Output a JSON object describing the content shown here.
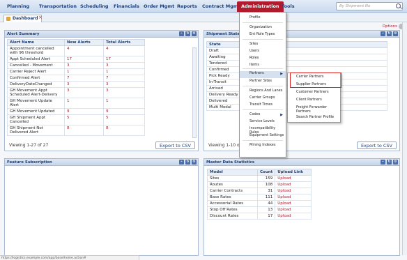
{
  "nav": {
    "items": [
      "Planning",
      "Transportation",
      "Scheduling",
      "Financials",
      "Order Mgmt",
      "Reports",
      "Contract Mgmt",
      "Administration",
      "Tools"
    ],
    "active": "Administration",
    "search_placeholder": "By Shipment No"
  },
  "tab": {
    "label": "Dashboard",
    "close": "×"
  },
  "options_label": "Options",
  "alert_summary": {
    "title": "Alert Summary",
    "columns": [
      "Alert Name",
      "New Alerts",
      "Total Alerts"
    ],
    "rows": [
      [
        "Appointment cancelled with 96 threshold",
        "4",
        "4"
      ],
      [
        "Appt Scheduled Alert",
        "17",
        "17"
      ],
      [
        "Cancelled - Movement",
        "3",
        "3"
      ],
      [
        "Carrier Reject Alert",
        "1",
        "1"
      ],
      [
        "Confirmed Alert",
        "7",
        "7"
      ],
      [
        "DeliveryDateChanged",
        "3",
        "3"
      ],
      [
        "GH Movement Appt Scheduled Alert-Delivery",
        "3",
        "3"
      ],
      [
        "GH Movement Update Alert",
        "1",
        "1"
      ],
      [
        "GH Movement Updated",
        "9",
        "9"
      ],
      [
        "GH Shipment Appt Cancelled",
        "5",
        "5"
      ],
      [
        "GH Shipment Not Delivered Alert",
        "8",
        "8"
      ]
    ],
    "footer": "Viewing 1-27 of 27",
    "csv": "Export to CSV"
  },
  "shipment_state": {
    "title": "Shipment State Su",
    "column": "State",
    "rows": [
      "Draft",
      "Awaiting",
      "Tendered",
      "Confirmed",
      "Pick Ready",
      "In-Transit",
      "Arrived",
      "Delivery Ready",
      "Delivered",
      "Multi Modal"
    ],
    "footer": "Viewing 1-10 of",
    "csv": "Export to CSV"
  },
  "feature_subscription": {
    "title": "Feature Subscription"
  },
  "master_data": {
    "title": "Master Data Statistics",
    "columns": [
      "Model",
      "Count",
      "Upload Link"
    ],
    "rows": [
      [
        "Sites",
        "159",
        "Upload"
      ],
      [
        "Routes",
        "108",
        "Upload"
      ],
      [
        "Carrier Contracts",
        "31",
        "Upload"
      ],
      [
        "Base Rates",
        "111",
        "Upload"
      ],
      [
        "Accessorial Rates",
        "44",
        "Upload"
      ],
      [
        "Stop Off Rates",
        "13",
        "Upload"
      ],
      [
        "Discount Rates",
        "17",
        "Upload"
      ]
    ]
  },
  "admin_menu": {
    "items": [
      "Profile",
      "Organization",
      "Ent Role Types",
      "Sites",
      "Users",
      "Roles",
      "Items",
      "Partners",
      "Partner Sites",
      "Regions And Lanes",
      "Carrier Groups",
      "Transit Times",
      "Codes",
      "Service Levels",
      "Incompatibility Rules",
      "Equipment Settings",
      "Mining Indexes"
    ],
    "highlighted": "Partners"
  },
  "partners_submenu": {
    "items": [
      "Carrier Partners",
      "Supplier Partners",
      "Customer Partners",
      "Client Partners",
      "Freight Forwarder Partners",
      "Search Partner Profile"
    ]
  },
  "status_url": "https://logistics.example.com/app/base/home.action#"
}
